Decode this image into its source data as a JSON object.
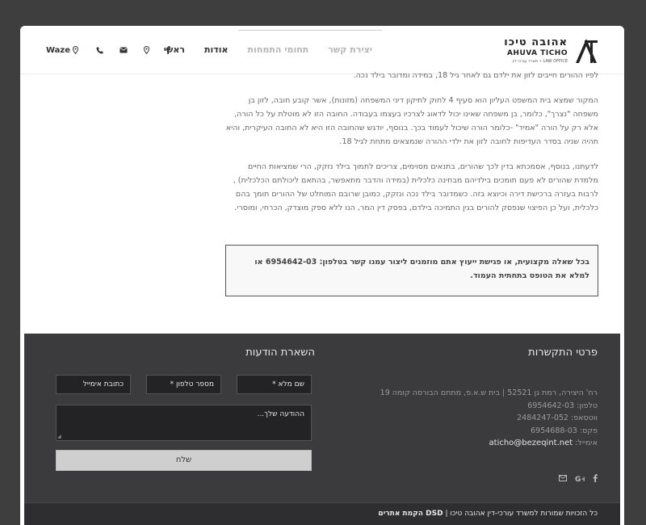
{
  "header": {
    "logo_he": "אהובה טיכו",
    "logo_en": "AHUVA TICHO",
    "logo_sub": "LAW OFFICE • משרד עורכי דין",
    "nav": [
      {
        "label": "ראשי",
        "muted": false
      },
      {
        "label": "אודות",
        "muted": false
      },
      {
        "label": "תחומי התמחות",
        "muted": true
      },
      {
        "label": "יצירת קשר",
        "muted": true
      }
    ],
    "waze_label": "Waze"
  },
  "content": {
    "paragraphs": [
      "לפיו ההורים חייבים לזון את ילדם גם לאחר גיל 18, במידה ומדובר בילד נכה.",
      "המקור שמצא בית המשפט העליון הוא סעיף 4 לחוק לתיקון דיני המשפחה (מזונות), אשר קובע חובה, לזון בן משפחה \"נצרך\", כלומר, בן משפחה שאינו יכול לדאוג לצרכיו בעצמו בעבודה. החובה הזו לא מוטלת על כל הורה, אלא רק על הורה \"אמיד\" -כלומר הורה שיכול לעמוד בכך. בנוסף, יודגש שהחובה הזו היא לא החובה העיקרית, והיא תהיה שניה בסדר העדיפות לחובה לזון את ילדי ההורה שנמצאים מתחת לגיל 18.",
      "לדעתנו, בנוסף, אסמכתא בדין לכך שהורים, בתנאים מסוימים, צריכים לתמוך בילד נזקק, הרי שמציאות החיים מלמדת שהורים לא פעם תומכים בילדיהם מבחינה כלכלית (במידה והדבר מתאפשר, בהתאם ליכולתם הכלכלית) , לרבות בעזרה ברכישת דירה וכיוצא בזה. כשמדובר בילד נכה ונזקק, כמובן שרובם המוחלט של ההורים תומך בהם כלכלית, ועל כן הפיצוי שנפסק להורים בגין התמיכה בילדם, בפסק דין המר, הנו ללא ספק מוצדק, הכרחי, ומוסרי."
    ],
    "notice": "בכל שאלה מקצועית, או פגישת ייעוץ אתם מוזמנים ליצור עמנו קשר בטלפון: 6954642-03 או למלא את הטופס בתחתית העמוד."
  },
  "footer": {
    "contact_title": "פרטי התקשרות",
    "message_title": "השארת הודעות",
    "address": "רח' היצירה, רמת גן 52521 | בית ש.א.פ, מתחם הבורסה קומה 19",
    "phone": "טלפון: 6954642-03",
    "whatsapp": "ווטסאפ: 2484247-052",
    "fax": "פקס: 6954688-03",
    "email_label": "אימייל:",
    "email": "aticho@bezeqint.net",
    "form": {
      "name_placeholder": "שם מלא *",
      "phone_placeholder": "מספר טלפון *",
      "email_placeholder": "כתובת אימייל",
      "message_placeholder": "ההודעה שלך...",
      "submit_label": "שלח"
    },
    "copyright_text": "כל הזכויות שמורות למשרד עורכי-דין אהובה טיכו |",
    "copyright_credit": "DSD הקמת אתרים"
  }
}
